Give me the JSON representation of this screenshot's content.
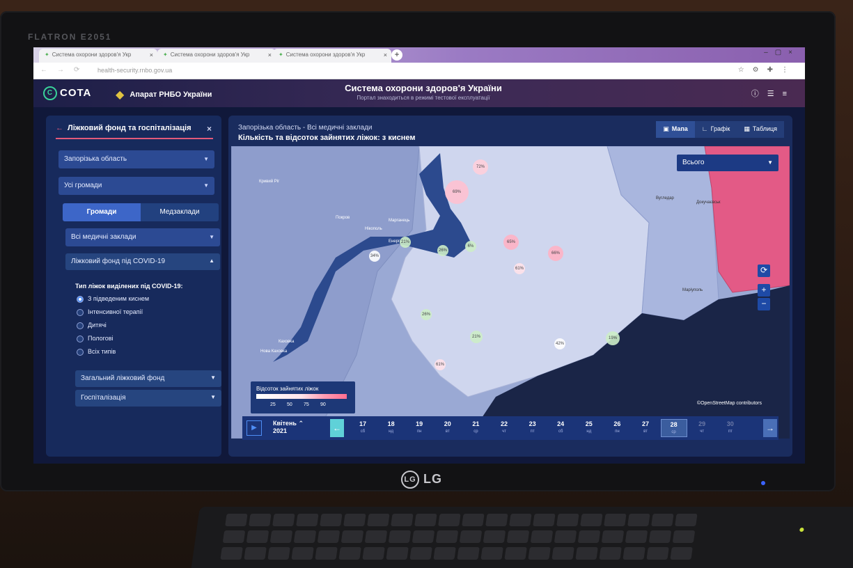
{
  "monitor": {
    "brand": "FLATRON E2051",
    "logo": "LG"
  },
  "browser": {
    "tabs": [
      {
        "title": "Система охорони здоров'я Укр",
        "favicon": "leaf-icon"
      },
      {
        "title": "Система охорони здоров'я Укр",
        "favicon": "leaf-icon"
      },
      {
        "title": "Система охорони здоров'я Укр",
        "favicon": "leaf-icon"
      }
    ],
    "url": "health-security.rnbo.gov.ua"
  },
  "header": {
    "brand_cota": "COTA",
    "brand_rnbo": "Апарат РНБО України",
    "title": "Система охорони здоров'я України",
    "subtitle": "Портал знаходиться в режимі тестової експлуатації"
  },
  "sidebar": {
    "title": "Ліжковий фонд та госпіталізація",
    "region_select": "Запорізька область",
    "community_select": "Усі громади",
    "seg_active": "Громади",
    "seg_inactive": "Медзаклади",
    "facility_select": "Всі медичні заклади",
    "covid_section": "Ліжковий фонд під COVID-19",
    "radio_label": "Тип ліжок виділених під COVID-19:",
    "radios": [
      {
        "label": "З підведеним киснем",
        "checked": true
      },
      {
        "label": "Інтенсивної терапії",
        "checked": false
      },
      {
        "label": "Дитячі",
        "checked": false
      },
      {
        "label": "Пологові",
        "checked": false
      },
      {
        "label": "Всіх типів",
        "checked": false
      }
    ],
    "total_section": "Загальний ліжковий фонд",
    "hosp_section": "Госпіталізація"
  },
  "main": {
    "crumb": "Запорізька область - Всі медичні заклади",
    "title": "Кількість та відсоток зайнятих ліжок: з киснем",
    "view_tabs": [
      {
        "label": "Мапа",
        "icon": "map-icon",
        "active": true
      },
      {
        "label": "Графік",
        "icon": "chart-icon",
        "active": false
      },
      {
        "label": "Таблиця",
        "icon": "table-icon",
        "active": false
      }
    ],
    "filter_select": "Всього",
    "legend_title": "Відсоток зайнятих ліжок",
    "legend_ticks": [
      "25",
      "50",
      "75",
      "90"
    ],
    "osm": "©OpenStreetMap contributors",
    "map_labels": [
      "Кривий Ріг",
      "Покров",
      "Нікополь",
      "Марганець",
      "Енергодар",
      "Каховка",
      "Нова Каховка",
      "Вугледар",
      "Докучаєвськ",
      "Маріуполь"
    ],
    "markers": [
      "72%",
      "69%",
      "34%",
      "21%",
      "26%",
      "6%",
      "65%",
      "66%",
      "61%",
      "26%",
      "21%",
      "42%",
      "19%",
      "61%"
    ]
  },
  "timeline": {
    "month": "Квітень",
    "year": "2021",
    "days": [
      {
        "num": "17",
        "dow": "сб"
      },
      {
        "num": "18",
        "dow": "нд"
      },
      {
        "num": "19",
        "dow": "пн"
      },
      {
        "num": "20",
        "dow": "вт"
      },
      {
        "num": "21",
        "dow": "ср"
      },
      {
        "num": "22",
        "dow": "чт"
      },
      {
        "num": "23",
        "dow": "пт"
      },
      {
        "num": "24",
        "dow": "сб"
      },
      {
        "num": "25",
        "dow": "нд"
      },
      {
        "num": "26",
        "dow": "пн"
      },
      {
        "num": "27",
        "dow": "вт"
      },
      {
        "num": "28",
        "dow": "ср",
        "selected": true
      },
      {
        "num": "29",
        "dow": "чт",
        "disabled": true
      },
      {
        "num": "30",
        "dow": "пт",
        "disabled": true
      }
    ]
  },
  "colors": {
    "accent": "#e25a7a",
    "panel": "#172a5c",
    "primary": "#3d66c8"
  }
}
